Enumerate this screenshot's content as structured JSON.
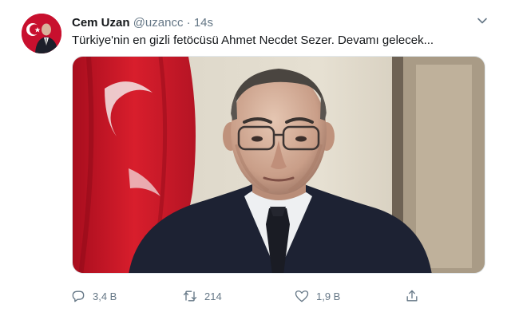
{
  "user": {
    "name": "Cem Uzan",
    "handle": "@uzancc",
    "separator": "·",
    "time": "14s",
    "avatar_icon": "profile-photo"
  },
  "tweet": {
    "text": "Türkiye'nin en gizli fetöcüsü Ahmet Necdet Sezer. Devamı gelecek...",
    "media_description_icon": "photo-of-man-before-turkish-flag"
  },
  "actions": {
    "reply": {
      "icon": "reply-icon",
      "count": "3,4 B"
    },
    "retweet": {
      "icon": "retweet-icon",
      "count": "214"
    },
    "like": {
      "icon": "heart-icon",
      "count": "1,9 B"
    },
    "share": {
      "icon": "share-icon"
    }
  },
  "colors": {
    "text_primary": "#14171a",
    "text_secondary": "#657786",
    "flag_red": "#c8102e"
  }
}
